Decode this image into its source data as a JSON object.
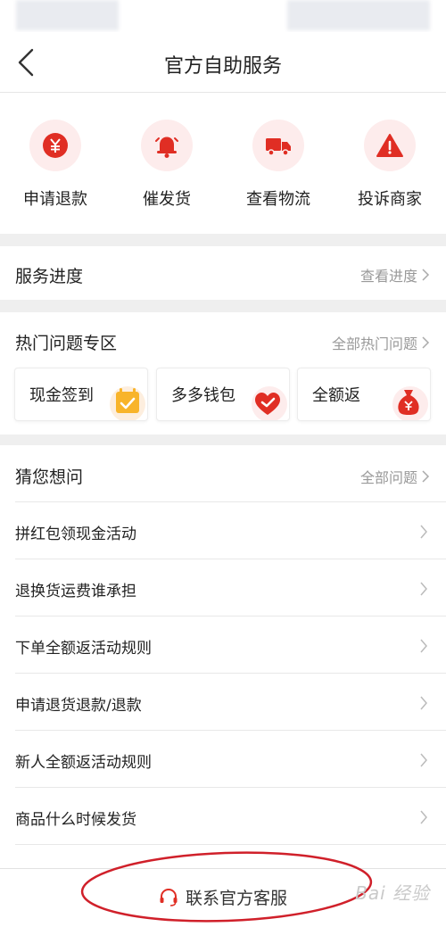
{
  "nav": {
    "title": "官方自助服务",
    "back_icon": "chevron-left-icon"
  },
  "actions": [
    {
      "label": "申请退款",
      "icon": "yen-coin-icon"
    },
    {
      "label": "催发货",
      "icon": "bell-icon"
    },
    {
      "label": "查看物流",
      "icon": "truck-icon"
    },
    {
      "label": "投诉商家",
      "icon": "warning-triangle-icon"
    }
  ],
  "service_progress": {
    "title": "服务进度",
    "link": "查看进度"
  },
  "hot_zone": {
    "title": "热门问题专区",
    "link": "全部热门问题",
    "cards": [
      {
        "label": "现金签到",
        "icon": "calendar-check-icon"
      },
      {
        "label": "多多钱包",
        "icon": "heart-check-icon"
      },
      {
        "label": "全额返",
        "icon": "money-bag-icon"
      }
    ]
  },
  "guess": {
    "title": "猜您想问",
    "link": "全部问题",
    "questions": [
      "拼红包领现金活动",
      "退换货运费谁承担",
      "下单全额返活动规则",
      "申请退货退款/退款",
      "新人全额返活动规则",
      "商品什么时候发货"
    ]
  },
  "bottom": {
    "contact_label": "联系官方客服",
    "icon": "headset-icon"
  },
  "watermark": "Bai 经验",
  "colors": {
    "accent": "#e02e24",
    "accent_light": "#fdecec",
    "yellow": "#f8b42a",
    "annotation": "#d0202a"
  }
}
